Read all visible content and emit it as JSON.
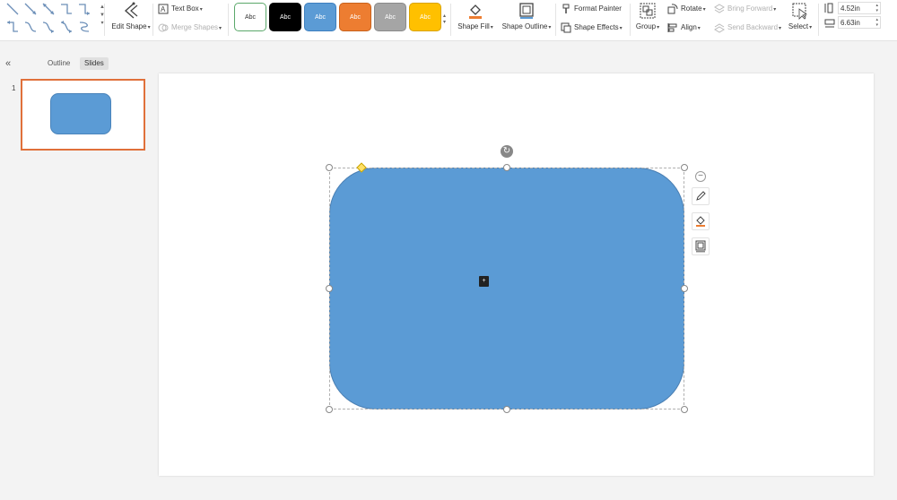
{
  "ribbon": {
    "edit_shape_label": "Edit Shape",
    "text_box_label": "Text Box",
    "merge_shapes_label": "Merge Shapes",
    "style_swatches": [
      {
        "label": "Abc",
        "bg": "#ffffff",
        "fg": "#333333",
        "border": "#5aa86a"
      },
      {
        "label": "Abc",
        "bg": "#000000",
        "fg": "#ffffff",
        "border": "#000000"
      },
      {
        "label": "Abc",
        "bg": "#5b9bd5",
        "fg": "#ffffff",
        "border": "#3d7fbf"
      },
      {
        "label": "Abc",
        "bg": "#ed7d31",
        "fg": "#ffffff",
        "border": "#c8621c"
      },
      {
        "label": "Abc",
        "bg": "#a5a5a5",
        "fg": "#ffffff",
        "border": "#8a8a8a"
      },
      {
        "label": "Abc",
        "bg": "#ffc000",
        "fg": "#ffffff",
        "border": "#d9a300"
      }
    ],
    "shape_fill_label": "Shape Fill",
    "shape_outline_label": "Shape Outline",
    "format_painter_label": "Format Painter",
    "shape_effects_label": "Shape Effects",
    "group_label": "Group",
    "rotate_label": "Rotate",
    "align_label": "Align",
    "bring_forward_label": "Bring Forward",
    "send_backward_label": "Send Backward",
    "select_label": "Select",
    "height_value": "4.52in",
    "width_value": "6.63in"
  },
  "left_pane": {
    "tabs": [
      "Outline",
      "Slides"
    ],
    "active_tab": "Slides",
    "slide_number": "1"
  },
  "colors": {
    "shape_fill": "#5b9bd5",
    "accent": "#e0703a",
    "handle_adjust": "#ffe066"
  },
  "icons": [
    "line-shape-icon",
    "edit-shape-icon",
    "text-box-icon",
    "merge-shapes-icon",
    "shape-fill-icon",
    "shape-outline-icon",
    "format-painter-icon",
    "shape-effects-icon",
    "group-icon",
    "rotate-icon",
    "align-icon",
    "bring-forward-icon",
    "send-backward-icon",
    "select-icon",
    "height-icon",
    "width-icon",
    "collapse-icon",
    "rotate-handle-icon",
    "minus-icon",
    "pen-icon",
    "fill-bucket-icon",
    "outline-icon"
  ]
}
